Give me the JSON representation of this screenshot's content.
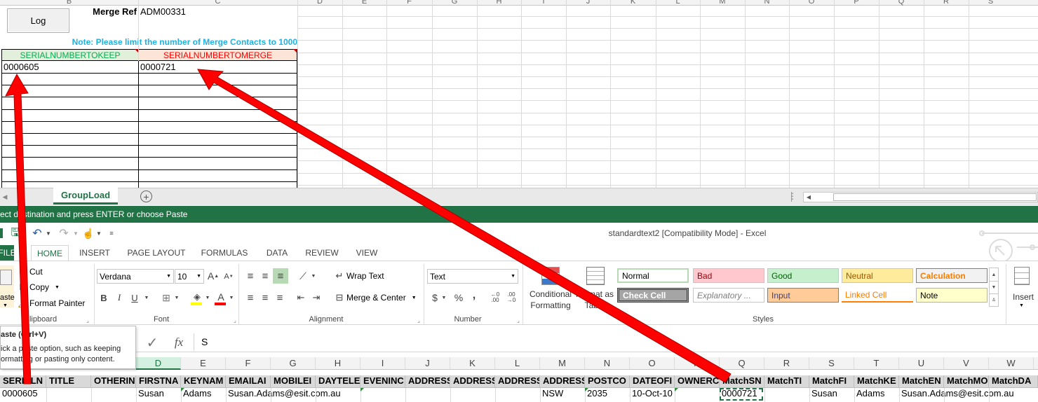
{
  "top_sheet": {
    "columns": [
      "B",
      "C",
      "D",
      "E",
      "F",
      "G",
      "H",
      "I",
      "J",
      "K",
      "L",
      "M",
      "N",
      "O",
      "P",
      "Q",
      "R",
      "S"
    ],
    "log_button": "Log",
    "merge_ref_label": "Merge Ref",
    "merge_ref_value": "ADM00331",
    "note": "Note:  Please limit the number of Merge Contacts to 1000",
    "keep_header": "SERIALNUMBERTOKEEP",
    "merge_header": "SERIALNUMBERTOMERGE",
    "keep_value": "0000605",
    "merge_value": "0000721",
    "keep_header_color": "#00b050",
    "merge_header_color": "#ff0000",
    "note_color": "#1fb1e0"
  },
  "tabs": {
    "active_sheet": "GroupLoad",
    "add_sheet_icon": "plus-circle-icon"
  },
  "status_bar": {
    "message": "ect destination and press ENTER or choose Paste"
  },
  "window": {
    "title": "standardtext2  [Compatibility Mode] - Excel"
  },
  "ribbon_tabs": [
    "FILE",
    "HOME",
    "INSERT",
    "PAGE LAYOUT",
    "FORMULAS",
    "DATA",
    "REVIEW",
    "VIEW"
  ],
  "ribbon": {
    "clipboard": {
      "cut": "Cut",
      "copy": "Copy",
      "format_painter": "Format Painter",
      "paste": "aste",
      "label": "Clipboard"
    },
    "font": {
      "name": "Verdana",
      "size": "10",
      "label": "Font",
      "bold": "B",
      "italic": "I",
      "underline": "U"
    },
    "alignment": {
      "wrap_text": "Wrap Text",
      "merge_center": "Merge & Center",
      "label": "Alignment"
    },
    "number": {
      "format": "Text",
      "label": "Number",
      "currency": "$",
      "percent": "%",
      "comma": ","
    },
    "styles": {
      "conditional_formatting_1": "Conditional",
      "conditional_formatting_2": "Formatting",
      "format_as_table_1": "Format as",
      "format_as_table_2": "Table",
      "label": "Styles",
      "cells": [
        {
          "name": "Normal",
          "bg": "#ffffff",
          "fg": "#000000"
        },
        {
          "name": "Bad",
          "bg": "#ffc7ce",
          "fg": "#9c0006"
        },
        {
          "name": "Good",
          "bg": "#c6efce",
          "fg": "#006100"
        },
        {
          "name": "Neutral",
          "bg": "#ffeb9c",
          "fg": "#9c5700"
        },
        {
          "name": "Calculation",
          "bg": "#f2f2f2",
          "fg": "#fa7d00"
        },
        {
          "name": "Check Cell",
          "bg": "#a5a5a5",
          "fg": "#ffffff"
        },
        {
          "name": "Explanatory ...",
          "bg": "#ffffff",
          "fg": "#7f7f7f"
        },
        {
          "name": "Input",
          "bg": "#ffcc99",
          "fg": "#3f3f76"
        },
        {
          "name": "Linked Cell",
          "bg": "#ffffff",
          "fg": "#fa7d00"
        },
        {
          "name": "Note",
          "bg": "#ffffcc",
          "fg": "#000000"
        }
      ]
    },
    "cells_group": {
      "insert": "Insert"
    }
  },
  "tooltip": {
    "title": "aste (Ctrl+V)",
    "line1": "ick a paste option, such as keeping",
    "line2": "ormatting or pasting only content."
  },
  "formula_bar": {
    "fx": "fx",
    "value": "S"
  },
  "bottom_sheet": {
    "columns": [
      "D",
      "E",
      "F",
      "G",
      "H",
      "I",
      "J",
      "K",
      "L",
      "M",
      "N",
      "O",
      "P",
      "Q",
      "R",
      "S",
      "T",
      "U",
      "V",
      "W"
    ],
    "headers": [
      "SERIALN",
      "TITLE",
      "OTHERIN",
      "FIRSTNA",
      "KEYNAM",
      "EMAILAI",
      "MOBILEI",
      "DAYTELE",
      "EVENINC",
      "ADDRESS",
      "ADDRESS",
      "ADDRESS",
      "ADDRESS",
      "POSTCO",
      "DATEOFI",
      "OWNERC",
      "MatchSN",
      "MatchTI",
      "MatchFI",
      "MatchKE",
      "MatchEN",
      "MatchMO",
      "MatchDA"
    ],
    "row": {
      "serial": "0000605",
      "first": "Susan",
      "key": "Adams",
      "email": "Susan.Adams@esit.com.au",
      "state": "NSW",
      "postcode": "2035",
      "date": "10-Oct-10",
      "match_sn": "0000721",
      "match_first": "Susan",
      "match_key": "Adams",
      "match_email": "Susan.Adams@esit.com.au"
    }
  },
  "colors": {
    "excel_green": "#217346",
    "arrow_red": "#ff0000"
  }
}
